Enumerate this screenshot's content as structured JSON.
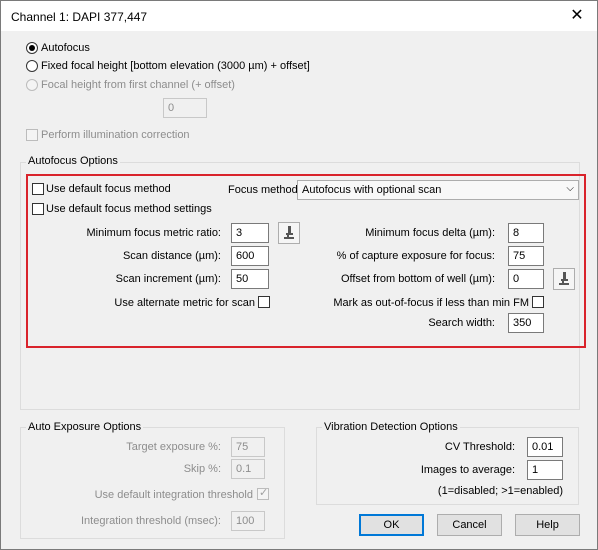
{
  "window": {
    "title": "Channel 1: DAPI 377,447",
    "close_glyph": "✕"
  },
  "focus_mode": {
    "autofocus_label": "Autofocus",
    "fixed_label": "Fixed focal height [bottom elevation (3000 µm) + offset]",
    "first_channel_label": "Focal height from first channel (+ offset)",
    "offset_value": "0"
  },
  "illumination_label": "Perform illumination correction",
  "autofocus_options": {
    "group_title": "Autofocus Options",
    "use_default_method_label": "Use default focus method",
    "use_default_settings_label": "Use default focus method settings",
    "focus_method_label": "Focus method:",
    "focus_method_value": "Autofocus with optional scan",
    "min_metric_ratio_label": "Minimum focus metric ratio:",
    "min_metric_ratio_value": "3",
    "scan_distance_label": "Scan distance (µm):",
    "scan_distance_value": "600",
    "scan_increment_label": "Scan increment (µm):",
    "scan_increment_value": "50",
    "alternate_metric_label": "Use alternate metric for scan",
    "min_delta_label": "Minimum focus delta (µm):",
    "min_delta_value": "8",
    "capture_exposure_label": "% of capture exposure for focus:",
    "capture_exposure_value": "75",
    "offset_bottom_label": "Offset from bottom of well (µm):",
    "offset_bottom_value": "0",
    "mark_out_of_focus_label": "Mark as out-of-focus if less than min FM",
    "search_width_label": "Search width:",
    "search_width_value": "350",
    "highlight_color": "#d9232b"
  },
  "auto_exposure": {
    "group_title": "Auto Exposure Options",
    "target_label": "Target exposure %:",
    "target_value": "75",
    "skip_label": "Skip %:",
    "skip_value": "0.1",
    "default_integration_label": "Use default integration threshold",
    "integration_label": "Integration threshold (msec):",
    "integration_value": "100"
  },
  "vibration": {
    "group_title": "Vibration Detection Options",
    "cv_label": "CV Threshold:",
    "cv_value": "0.01",
    "images_label": "Images to average:",
    "images_value": "1",
    "note": "(1=disabled; >1=enabled)"
  },
  "buttons": {
    "ok": "OK",
    "cancel": "Cancel",
    "help": "Help"
  }
}
